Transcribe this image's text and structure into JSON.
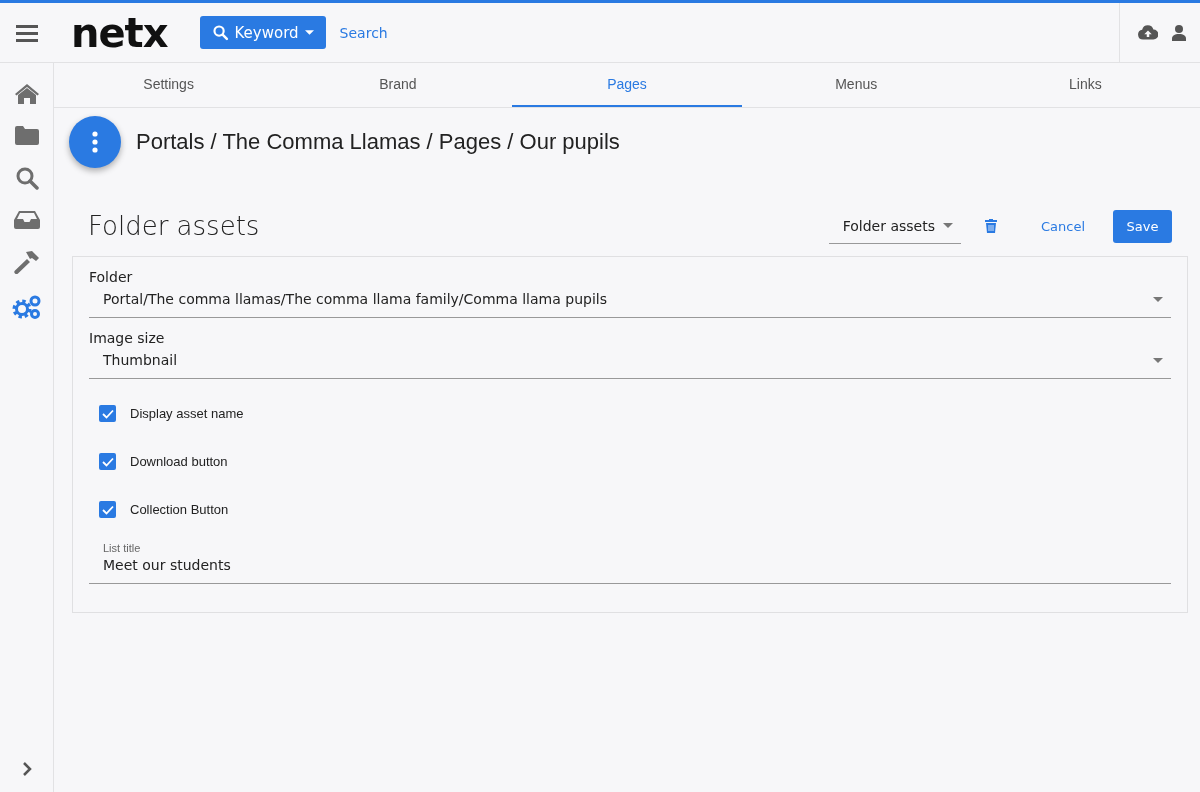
{
  "header": {
    "logo": "netx",
    "search_type": "Keyword",
    "search_placeholder": "Search"
  },
  "sidebar": {
    "items": [
      {
        "kind": "home",
        "selected": false
      },
      {
        "kind": "folder",
        "selected": false
      },
      {
        "kind": "search",
        "selected": false
      },
      {
        "kind": "inbox",
        "selected": false
      },
      {
        "kind": "hammer",
        "selected": false
      },
      {
        "kind": "gears",
        "selected": true
      }
    ]
  },
  "tabs": [
    {
      "label": "Settings",
      "selected": false
    },
    {
      "label": "Brand",
      "selected": false
    },
    {
      "label": "Pages",
      "selected": true
    },
    {
      "label": "Menus",
      "selected": false
    },
    {
      "label": "Links",
      "selected": false
    }
  ],
  "breadcrumb": "Portals / The Comma Llamas / Pages / Our pupils",
  "section": {
    "title": "Folder assets",
    "type_select": "Folder assets",
    "cancel": "Cancel",
    "save": "Save"
  },
  "form": {
    "selects": [
      {
        "label": "Folder",
        "value": "Portal/The comma llamas/The comma llama family/Comma llama pupils"
      },
      {
        "label": "Image size",
        "value": "Thumbnail"
      }
    ],
    "checkboxes": [
      {
        "label": "Display asset name",
        "checked": true
      },
      {
        "label": "Download button",
        "checked": true
      },
      {
        "label": "Collection Button",
        "checked": true
      }
    ],
    "text_field": {
      "label": "List title",
      "value": "Meet our students"
    }
  }
}
